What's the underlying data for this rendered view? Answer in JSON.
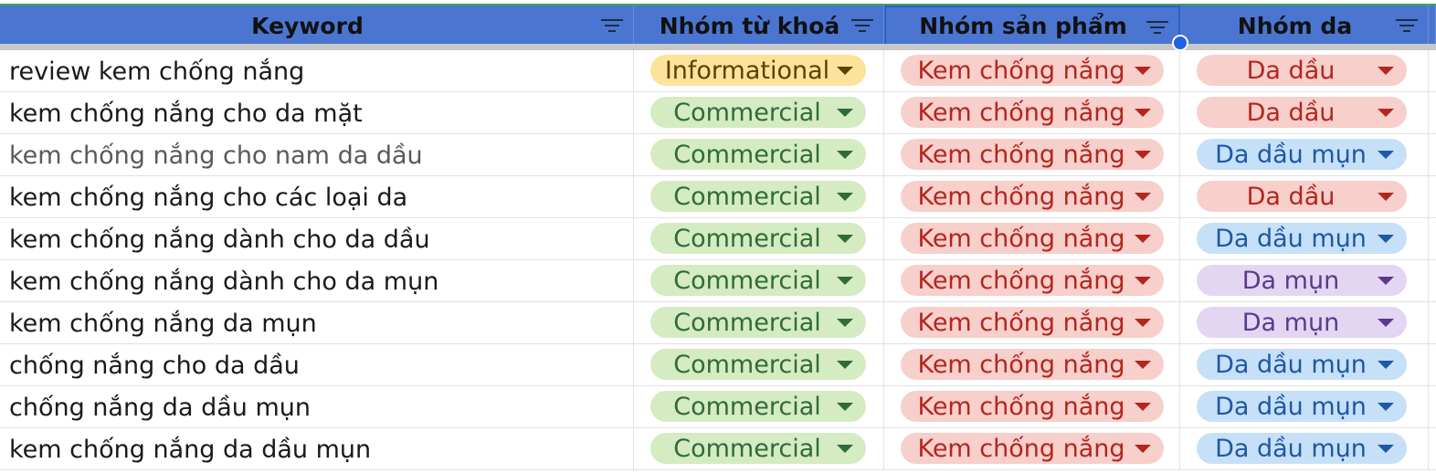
{
  "headers": {
    "keyword": "Keyword",
    "intent": "Nhóm từ khoá",
    "product": "Nhóm sản phẩm",
    "skin": "Nhóm da"
  },
  "icons": {
    "filter": "filter-icon",
    "dropdown": "dropdown-arrow-icon"
  },
  "chip_styles": {
    "Informational": {
      "bg": "#fde39a",
      "fg": "#5a4200",
      "arrow": "#5a4200"
    },
    "Commercial": {
      "bg": "#d5ebc2",
      "fg": "#2f6b3b",
      "arrow": "#2f6b3b"
    },
    "Kem chống nắng": {
      "bg": "#f7cfcb",
      "fg": "#b3261e",
      "arrow": "#b3261e"
    },
    "Da dầu": {
      "bg": "#f7cfcb",
      "fg": "#b3261e",
      "arrow": "#b3261e"
    },
    "Da dầu mụn": {
      "bg": "#c6e0f7",
      "fg": "#1f58a6",
      "arrow": "#1f58a6"
    },
    "Da mụn": {
      "bg": "#e3d6f3",
      "fg": "#5b3a8c",
      "arrow": "#5b3a8c"
    }
  },
  "header_colors": {
    "background": "#4a76d2",
    "text": "#111111"
  },
  "rows": [
    {
      "keyword": "review kem chống nắng",
      "intent": "Informational",
      "product": "Kem chống nắng",
      "skin": "Da dầu"
    },
    {
      "keyword": "kem chống nắng cho da mặt",
      "intent": "Commercial",
      "product": "Kem chống nắng",
      "skin": "Da dầu"
    },
    {
      "keyword": "kem chống nắng cho nam da dầu",
      "intent": "Commercial",
      "product": "Kem chống nắng",
      "skin": "Da dầu mụn"
    },
    {
      "keyword": "kem chống nắng cho các loại da",
      "intent": "Commercial",
      "product": "Kem chống nắng",
      "skin": "Da dầu"
    },
    {
      "keyword": "kem chống nắng dành cho da dầu",
      "intent": "Commercial",
      "product": "Kem chống nắng",
      "skin": "Da dầu mụn"
    },
    {
      "keyword": "kem chống nắng dành cho da mụn",
      "intent": "Commercial",
      "product": "Kem chống nắng",
      "skin": "Da mụn"
    },
    {
      "keyword": "kem chống nắng da mụn",
      "intent": "Commercial",
      "product": "Kem chống nắng",
      "skin": "Da mụn"
    },
    {
      "keyword": "chống nắng cho da dầu",
      "intent": "Commercial",
      "product": "Kem chống nắng",
      "skin": "Da dầu mụn"
    },
    {
      "keyword": "chống nắng da dầu mụn",
      "intent": "Commercial",
      "product": "Kem chống nắng",
      "skin": "Da dầu mụn"
    },
    {
      "keyword": "kem chống nắng da dầu mụn",
      "intent": "Commercial",
      "product": "Kem chống nắng",
      "skin": "Da dầu mụn"
    }
  ]
}
